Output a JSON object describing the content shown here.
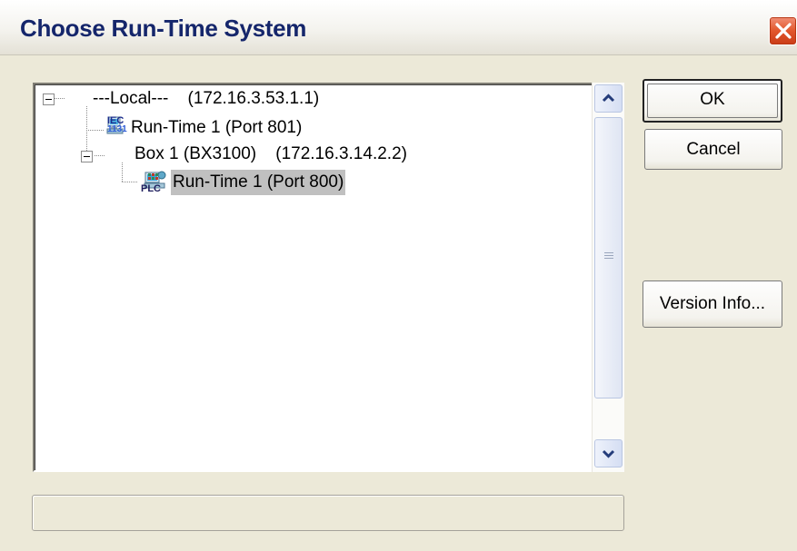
{
  "window": {
    "title": "Choose Run-Time System",
    "close_icon": "close-icon"
  },
  "tree": {
    "nodes": [
      {
        "label": "---Local---    (172.16.3.53.1.1)",
        "icon": "computer-icon",
        "expanded": true
      },
      {
        "label": "Run-Time 1 (Port 801)",
        "icon": "iec-1131-icon"
      },
      {
        "label": "Box 1 (BX3100)    (172.16.3.14.2.2)",
        "icon": "network-computer-icon",
        "expanded": true
      },
      {
        "label": "Run-Time 1 (Port 800)",
        "icon": "plc-icon",
        "selected": true
      }
    ],
    "iec_icon_text": "IEC",
    "iec_icon_subtext": "1131",
    "plc_icon_text": "PLC"
  },
  "buttons": {
    "ok": "OK",
    "cancel": "Cancel",
    "version_info": "Version Info..."
  },
  "status": {
    "text": ""
  },
  "colors": {
    "title_text": "#15266b",
    "selection": "#c0c0c0",
    "dialog_bg": "#ece9d8"
  }
}
